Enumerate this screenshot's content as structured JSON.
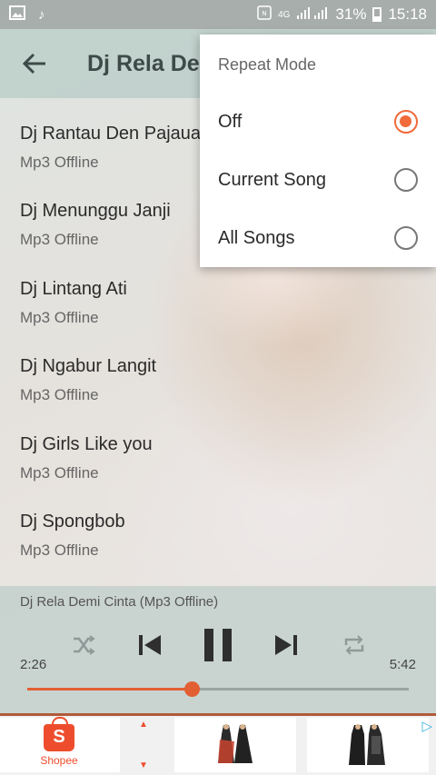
{
  "status_bar": {
    "network": "4G",
    "battery": "31%",
    "time": "15:18",
    "icons": [
      "image-icon",
      "music-note-icon",
      "nfc-icon",
      "signal-icon",
      "battery-icon"
    ]
  },
  "app_bar": {
    "title": "Dj Rela Demi Cinta"
  },
  "songs": [
    {
      "title": "Dj Rantau Den Pajauah",
      "subtitle": "Mp3 Offline"
    },
    {
      "title": "Dj Menunggu Janji",
      "subtitle": "Mp3 Offline"
    },
    {
      "title": "Dj Lintang Ati",
      "subtitle": "Mp3 Offline"
    },
    {
      "title": "Dj Ngabur Langit",
      "subtitle": "Mp3 Offline"
    },
    {
      "title": "Dj Girls Like you",
      "subtitle": "Mp3 Offline"
    },
    {
      "title": "Dj Spongbob",
      "subtitle": "Mp3 Offline"
    }
  ],
  "player": {
    "now_playing": "Dj Rela Demi Cinta (Mp3 Offline)",
    "current_time": "2:26",
    "total_time": "5:42",
    "progress": 0.43,
    "accent_color": "#e25f34"
  },
  "repeat_menu": {
    "title": "Repeat Mode",
    "options": [
      {
        "label": "Off",
        "selected": true
      },
      {
        "label": "Current Song",
        "selected": false
      },
      {
        "label": "All Songs",
        "selected": false
      }
    ]
  },
  "ad": {
    "brand": "Shopee",
    "logo_letter": "S"
  }
}
